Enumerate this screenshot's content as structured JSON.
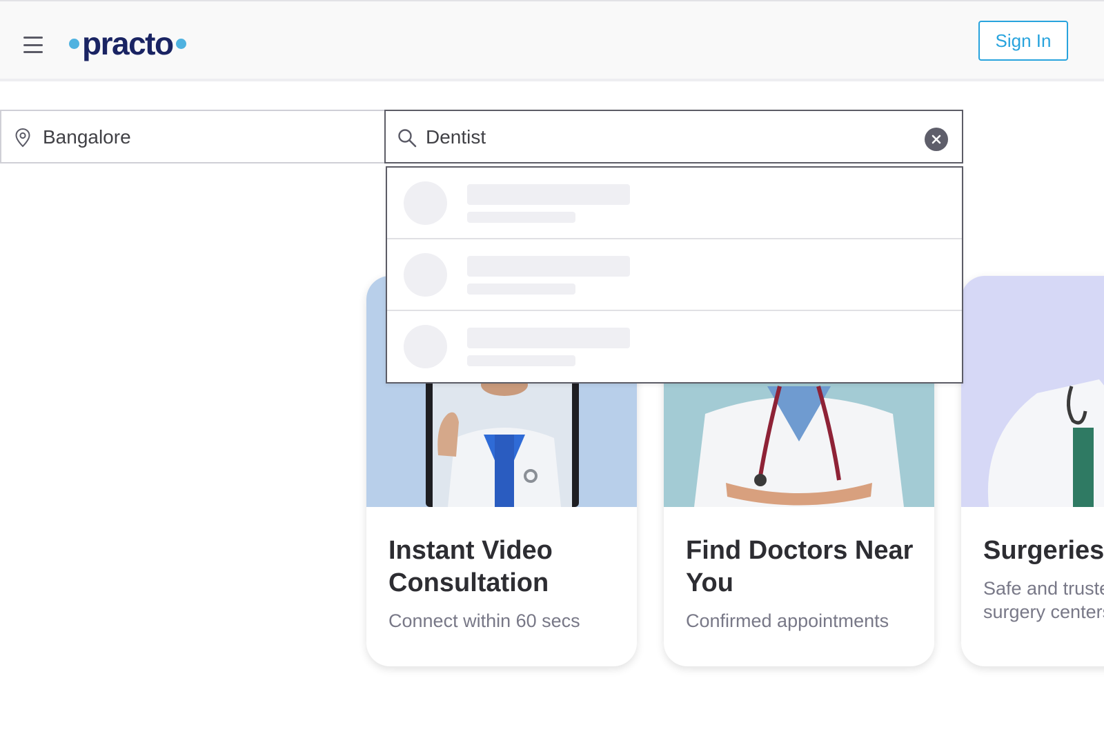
{
  "header": {
    "menu_icon": "hamburger-menu-icon",
    "logo_text": "practo",
    "signin_label": "Sign In",
    "brand_color": "#1a2463",
    "accent_color": "#28a3dd"
  },
  "search": {
    "location_icon": "map-pin-icon",
    "location_value": "Bangalore",
    "query_icon": "search-icon",
    "query_value": "Dentist",
    "clear_icon": "clear-icon",
    "suggestions_state": "loading"
  },
  "cards": [
    {
      "title": "Instant Video Consultation",
      "subtitle": "Connect within 60 secs",
      "image_bg": "#b8cfea"
    },
    {
      "title": "Find Doctors Near You",
      "subtitle": "Confirmed appointments",
      "image_bg": "#a3cbd4"
    },
    {
      "title": "Surgeries",
      "subtitle": "Safe and trusted surgery centers",
      "image_bg": "#d6d8f6"
    }
  ]
}
